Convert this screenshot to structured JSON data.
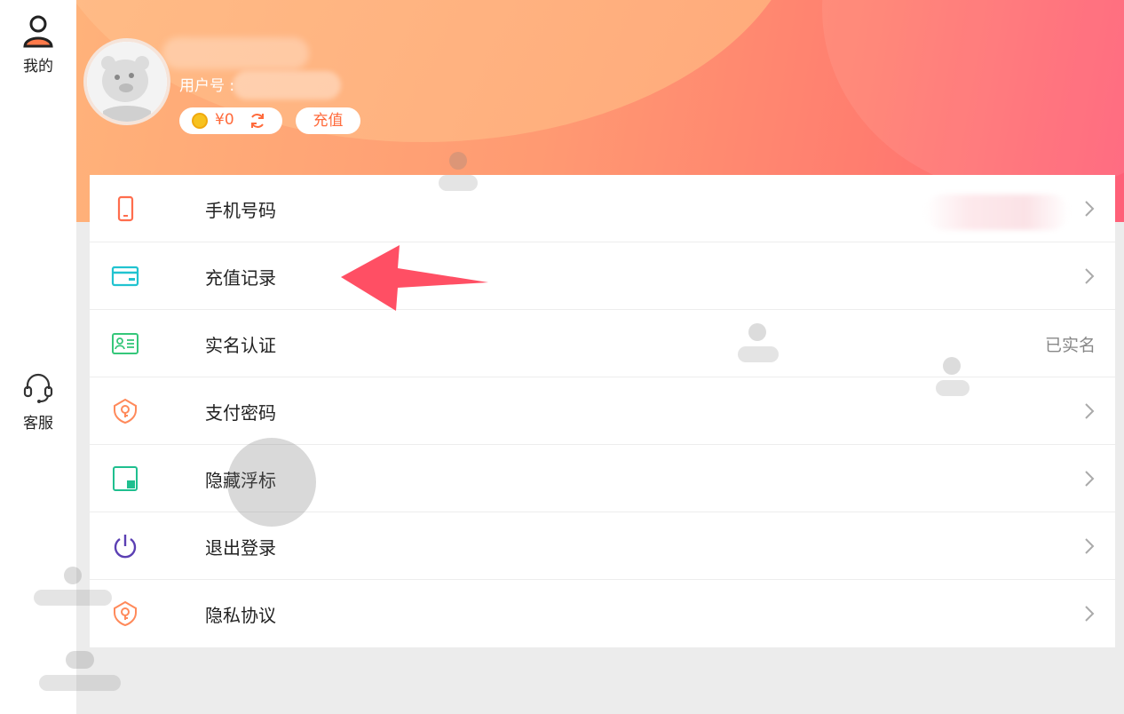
{
  "sidebar": {
    "items": [
      {
        "label": "我的",
        "icon": "user-icon"
      },
      {
        "label": "客服",
        "icon": "headset-icon"
      }
    ]
  },
  "profile": {
    "user_label": "用户号 :",
    "balance": "¥0",
    "recharge_label": "充值"
  },
  "menu": {
    "items": [
      {
        "label": "手机号码",
        "icon": "phone-icon",
        "value": ""
      },
      {
        "label": "充值记录",
        "icon": "card-icon",
        "value": ""
      },
      {
        "label": "实名认证",
        "icon": "id-card-icon",
        "value": "已实名"
      },
      {
        "label": "支付密码",
        "icon": "shield-key-icon",
        "value": ""
      },
      {
        "label": "隐藏浮标",
        "icon": "float-window-icon",
        "value": ""
      },
      {
        "label": "退出登录",
        "icon": "power-icon",
        "value": ""
      },
      {
        "label": "隐私协议",
        "icon": "shield-key-icon",
        "value": ""
      }
    ]
  },
  "colors": {
    "accent": "#ff6a3b",
    "arrow": "#ff4f64",
    "header_start": "#ffb27a",
    "header_end": "#ff5f78"
  }
}
